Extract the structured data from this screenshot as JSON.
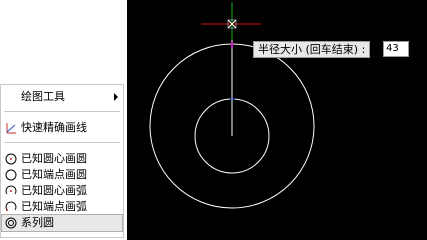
{
  "menu": {
    "items": [
      {
        "label": "绘图工具",
        "icon": "none",
        "submenu": true
      },
      {
        "label": "快速精确画线",
        "icon": "precise-line-icon"
      },
      {
        "label": "已知圆心画圆",
        "icon": "circle-center-icon"
      },
      {
        "label": "已知端点画圆",
        "icon": "circle-endpoint-icon"
      },
      {
        "label": "已知圆心画弧",
        "icon": "arc-center-icon"
      },
      {
        "label": "已知端点画弧",
        "icon": "arc-endpoint-icon"
      },
      {
        "label": "系列圆",
        "icon": "concentric-circles-icon",
        "selected": true
      }
    ]
  },
  "prompt": {
    "label": "半径大小 (回车结束) :",
    "value": "43"
  },
  "colors": {
    "canvas": "#000000",
    "circle": "#ffffff",
    "crosshair_h": "#d01010",
    "crosshair_v": "#10b010",
    "marker": "#c020c0"
  }
}
